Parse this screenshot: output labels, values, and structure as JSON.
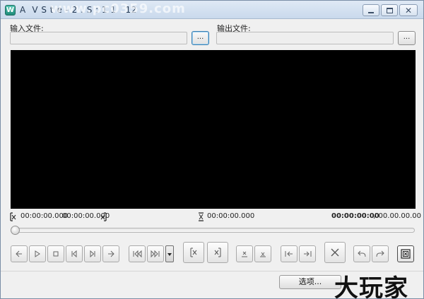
{
  "window": {
    "title": "A  V S t e - 2 . S : 1 1   12",
    "watermark": "www.pc0359.com",
    "app_icon_glyph": "W"
  },
  "input": {
    "label": "输入文件:",
    "value": "",
    "browse_label": "..."
  },
  "output": {
    "label": "输出文件:",
    "value": "",
    "browse_label": "..."
  },
  "times": {
    "cut_start": "00:00:00.000",
    "cut_end": "00:00:00.000",
    "split_time": "00:00:00.000",
    "current": "00:00:00:00",
    "total": "/ 00.00.00.00"
  },
  "seek": {
    "position_fraction": 0.0
  },
  "controls": [
    {
      "name": "seek-backward-button",
      "icon": "arrow-left-icon"
    },
    {
      "name": "play-button",
      "icon": "play-icon"
    },
    {
      "name": "stop-button",
      "icon": "stop-icon"
    },
    {
      "name": "previous-frame-button",
      "icon": "step-back-icon"
    },
    {
      "name": "next-frame-button",
      "icon": "step-forward-icon"
    },
    {
      "name": "seek-forward-button",
      "icon": "arrow-right-icon"
    },
    {
      "name": "go-to-start-button",
      "icon": "skip-start-icon"
    },
    {
      "name": "go-to-end-button",
      "icon": "skip-end-icon"
    },
    {
      "name": "set-cut-start-button",
      "icon": "cut-start-icon"
    },
    {
      "name": "set-cut-end-button",
      "icon": "cut-end-icon"
    },
    {
      "name": "add-split-button",
      "icon": "split-add-icon"
    },
    {
      "name": "remove-split-button",
      "icon": "split-remove-icon"
    },
    {
      "name": "go-to-cut-start-button",
      "icon": "jump-to-start-mark-icon"
    },
    {
      "name": "go-to-cut-end-button",
      "icon": "jump-to-end-mark-icon"
    },
    {
      "name": "delete-segment-button",
      "icon": "x-icon"
    },
    {
      "name": "undo-button",
      "icon": "undo-icon"
    },
    {
      "name": "redo-button",
      "icon": "redo-icon"
    },
    {
      "name": "save-button",
      "icon": "save-frame-icon"
    }
  ],
  "footer": {
    "options_label": "选项...",
    "brand_text": "大玩家"
  },
  "colors": {
    "video_background": "#000000",
    "window_background": "#f0f0f0",
    "titlebar": "#c9d9ec"
  }
}
